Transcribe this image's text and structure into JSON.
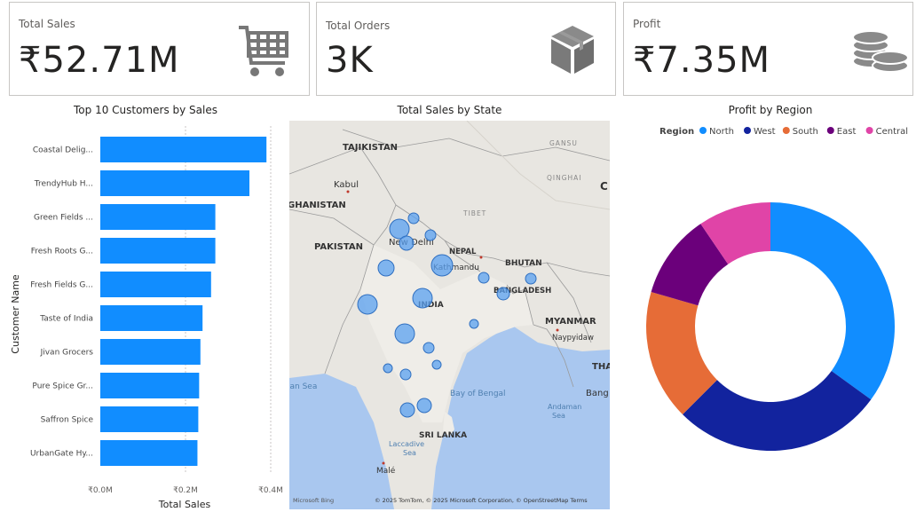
{
  "cards": [
    {
      "title": "Total Sales",
      "value": "₹52.71M",
      "icon": "shopping-cart-icon"
    },
    {
      "title": "Total Orders",
      "value": "3K",
      "icon": "box-icon"
    },
    {
      "title": "Profit",
      "value": "₹7.35M",
      "icon": "coins-icon"
    }
  ],
  "map": {
    "title": "Total Sales by State",
    "labels": {
      "tajikistan": "TAJIKISTAN",
      "kabul": "Kabul",
      "ghanistan": "GHANISTAN",
      "pakistan": "PAKISTAN",
      "new_delhi": "New Delhi",
      "nepal": "NEPAL",
      "kathmandu": "Kathmandu",
      "bhutan": "BHUTAN",
      "bangladesh": "BANGLADESH",
      "india": "INDIA",
      "tibet": "TIBET",
      "gansu": "GANSU",
      "qinghai": "QINGHAI",
      "myanmar": "MYANMAR",
      "naypyidaw": "Naypyidaw",
      "bay_of_bengal": "Bay of Bengal",
      "andaman_sea": "Andaman\nSea",
      "sri_lanka": "SRI LANKA",
      "lacca": "Laccadive\nSea",
      "male": "Malé",
      "bang": "Bang",
      "tha": "THA",
      "c": "C",
      "ian_sea": "ian Sea"
    },
    "attribution": "© 2025 TomTom, © 2025 Microsoft Corporation, © OpenStreetMap  Terms",
    "logo": "Microsoft Bing"
  },
  "chart_data": [
    {
      "type": "bar",
      "orientation": "horizontal",
      "title": "Top 10 Customers by Sales",
      "xlabel": "Total Sales",
      "ylabel": "Customer Name",
      "categories": [
        "Coastal Delig...",
        "TrendyHub H...",
        "Green Fields ...",
        "Fresh Roots G...",
        "Fresh Fields G...",
        "Taste of India",
        "Jivan Grocers",
        "Pure Spice Gr...",
        "Saffron Spice",
        "UrbanGate Hy..."
      ],
      "values": [
        0.39,
        0.35,
        0.27,
        0.27,
        0.26,
        0.24,
        0.235,
        0.232,
        0.23,
        0.228
      ],
      "unit": "₹M",
      "xlim": [
        0,
        0.4
      ],
      "xticks": [
        "₹0.0M",
        "₹0.2M",
        "₹0.4M"
      ],
      "color": "#118DFF",
      "grid": true
    },
    {
      "type": "pie",
      "variant": "donut",
      "title": "Profit by Region",
      "legend_title": "Region",
      "legend_position": "top",
      "categories": [
        "North",
        "West",
        "South",
        "East",
        "Central"
      ],
      "values": [
        35.0,
        27.5,
        17.0,
        11.0,
        9.5
      ],
      "colors": [
        "#118DFF",
        "#12239E",
        "#E66C37",
        "#6B007B",
        "#E044A7"
      ]
    }
  ]
}
